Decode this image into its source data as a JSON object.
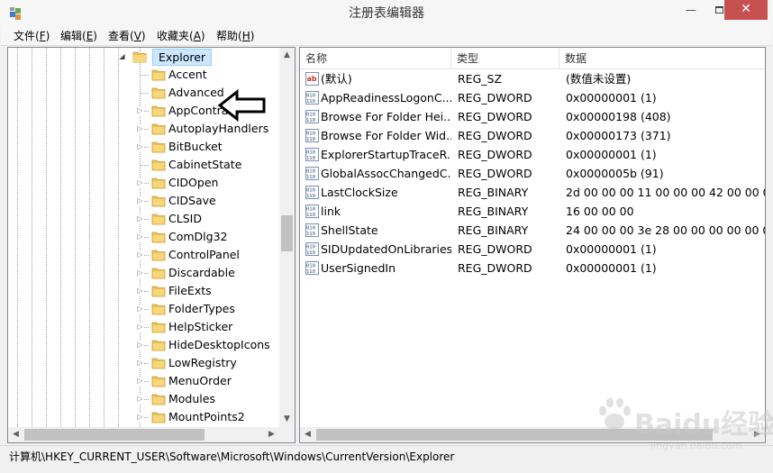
{
  "window": {
    "title": "注册表编辑器",
    "minimize": "—",
    "close": "✕"
  },
  "menu": [
    {
      "label": "文件(",
      "key": "F",
      "end": ")"
    },
    {
      "label": "编辑(",
      "key": "E",
      "end": ")"
    },
    {
      "label": "查看(",
      "key": "V",
      "end": ")"
    },
    {
      "label": "收藏夹(",
      "key": "A",
      "end": ")"
    },
    {
      "label": "帮助(",
      "key": "H",
      "end": ")"
    }
  ],
  "tree": {
    "selected": "Explorer",
    "children": [
      "Accent",
      "Advanced",
      "AppContract",
      "AutoplayHandlers",
      "BitBucket",
      "CabinetState",
      "CIDOpen",
      "CIDSave",
      "CLSID",
      "ComDlg32",
      "ControlPanel",
      "Discardable",
      "FileExts",
      "FolderTypes",
      "HelpSticker",
      "HideDesktopIcons",
      "LowRegistry",
      "MenuOrder",
      "Modules",
      "MountPoints2"
    ],
    "has_children": [
      false,
      false,
      true,
      true,
      true,
      false,
      true,
      true,
      true,
      true,
      true,
      true,
      true,
      true,
      true,
      true,
      true,
      true,
      true,
      true
    ]
  },
  "list": {
    "columns": {
      "name": "名称",
      "type": "类型",
      "data": "数据"
    },
    "rows": [
      {
        "icon": "string-value-icon",
        "name": "(默认)",
        "type": "REG_SZ",
        "data": "(数值未设置)"
      },
      {
        "icon": "binary-value-icon",
        "name": "AppReadinessLogonC...",
        "type": "REG_DWORD",
        "data": "0x00000001 (1)"
      },
      {
        "icon": "binary-value-icon",
        "name": "Browse For Folder Hei...",
        "type": "REG_DWORD",
        "data": "0x00000198 (408)"
      },
      {
        "icon": "binary-value-icon",
        "name": "Browse For Folder Wid...",
        "type": "REG_DWORD",
        "data": "0x00000173 (371)"
      },
      {
        "icon": "binary-value-icon",
        "name": "ExplorerStartupTraceR...",
        "type": "REG_DWORD",
        "data": "0x00000001 (1)"
      },
      {
        "icon": "binary-value-icon",
        "name": "GlobalAssocChangedC...",
        "type": "REG_DWORD",
        "data": "0x0000005b (91)"
      },
      {
        "icon": "binary-value-icon",
        "name": "LastClockSize",
        "type": "REG_BINARY",
        "data": "2d 00 00 00 11 00 00 00 42 00 00 00 1"
      },
      {
        "icon": "binary-value-icon",
        "name": "link",
        "type": "REG_BINARY",
        "data": "16 00 00 00"
      },
      {
        "icon": "binary-value-icon",
        "name": "ShellState",
        "type": "REG_BINARY",
        "data": "24 00 00 00 3e 28 00 00 00 00 00 00 0"
      },
      {
        "icon": "binary-value-icon",
        "name": "SIDUpdatedOnLibraries",
        "type": "REG_DWORD",
        "data": "0x00000001 (1)"
      },
      {
        "icon": "binary-value-icon",
        "name": "UserSignedIn",
        "type": "REG_DWORD",
        "data": "0x00000001 (1)"
      }
    ]
  },
  "statusbar": {
    "path": "计算机\\HKEY_CURRENT_USER\\Software\\Microsoft\\Windows\\CurrentVersion\\Explorer"
  },
  "watermark": {
    "brand": "Baidu经验",
    "url": "jingyan.baidu.com"
  },
  "colors": {
    "selection": "#cce8ff",
    "close_button": "#c75050",
    "folder": "#e8c25a"
  }
}
